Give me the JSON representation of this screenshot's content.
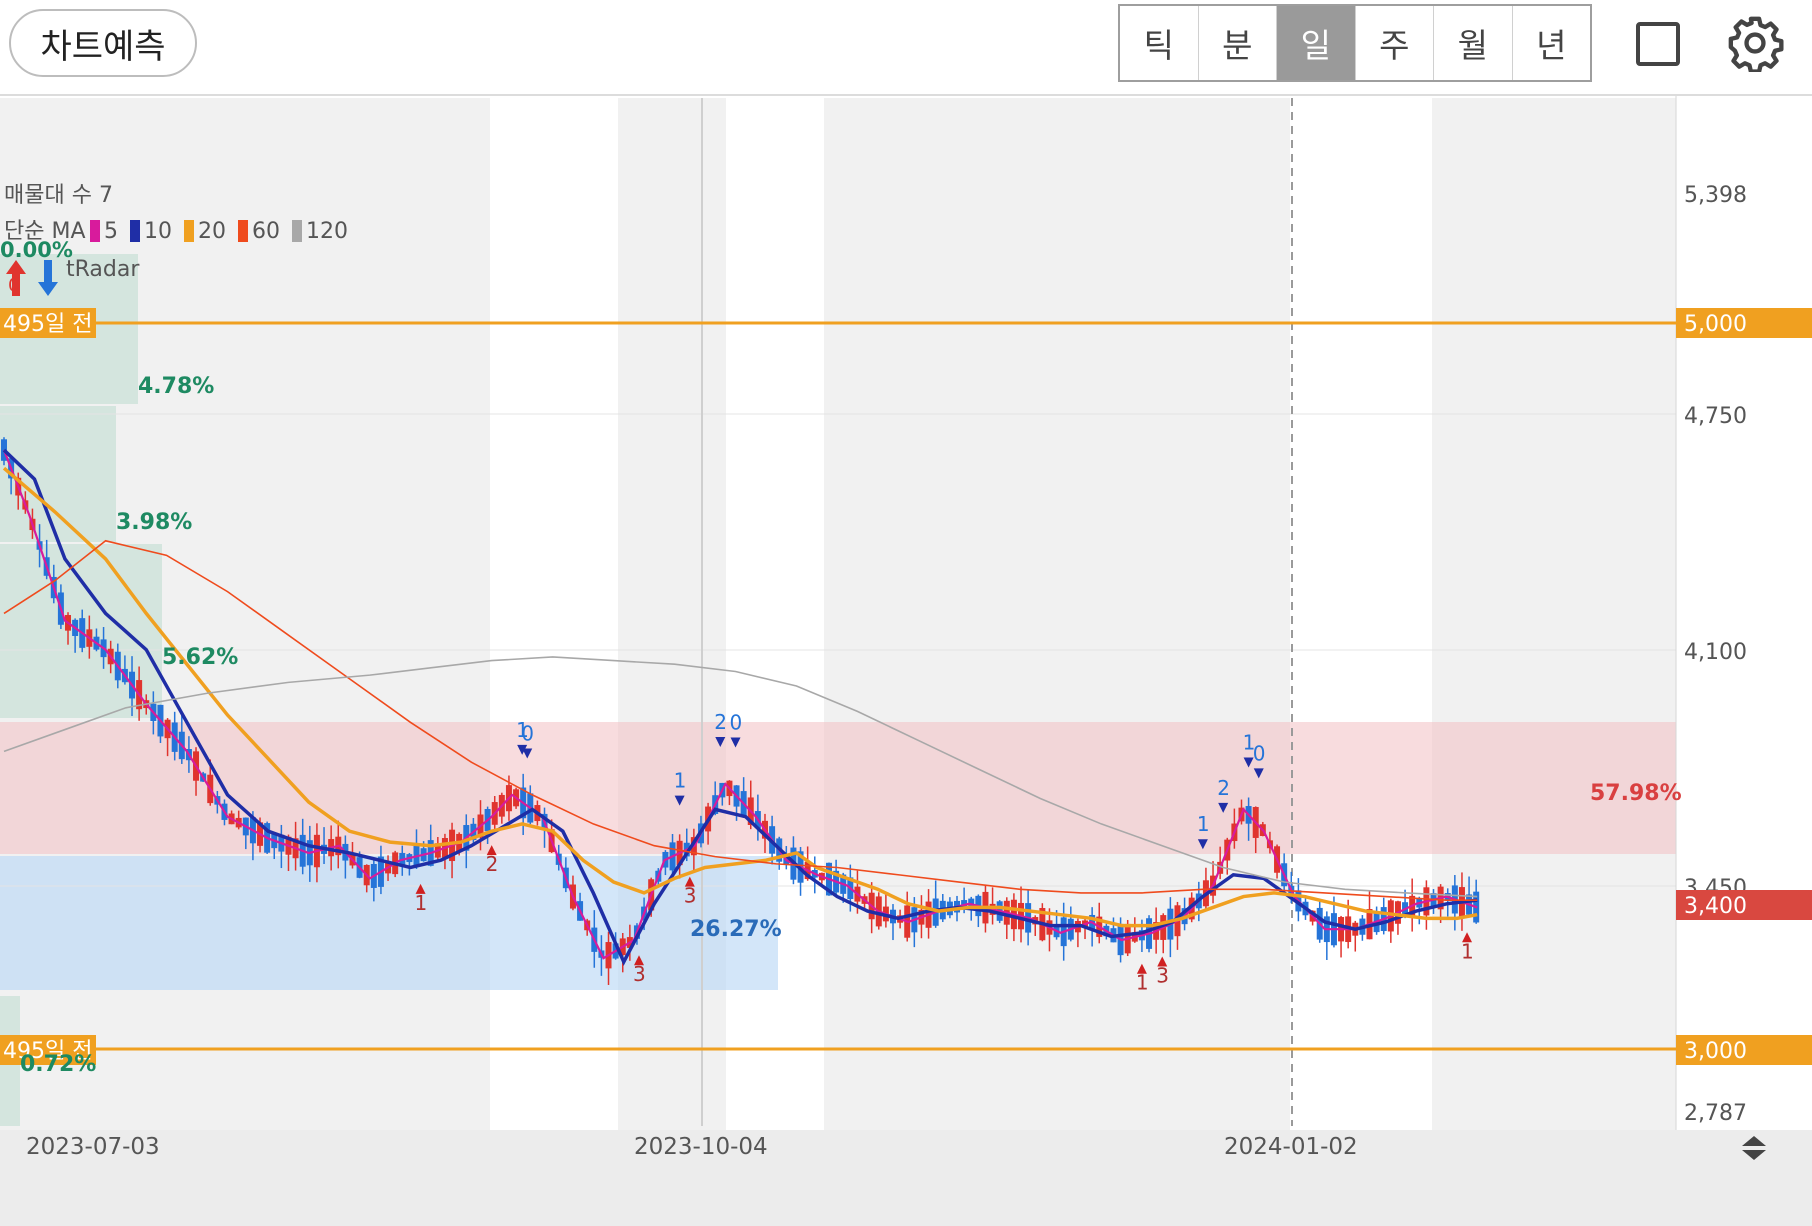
{
  "toolbar": {
    "predict_label": "차트예측",
    "periods": [
      "틱",
      "분",
      "일",
      "주",
      "월",
      "년"
    ],
    "active_period": "일",
    "fullscreen_icon": "square-icon",
    "settings_icon": "gear-icon"
  },
  "indicators": {
    "volume_profile": "매물대 수 7",
    "ma_prefix": "단순 MA",
    "ma_lines": [
      {
        "period": "5",
        "color": "#d81b9c"
      },
      {
        "period": "10",
        "color": "#1f2ea6"
      },
      {
        "period": "20",
        "color": "#f0a020"
      },
      {
        "period": "60",
        "color": "#ef4b1d"
      },
      {
        "period": "120",
        "color": "#a8a8a8"
      }
    ],
    "radar_label": "tRadar",
    "radar_pct": "0.00%",
    "radar_count": "0"
  },
  "colors": {
    "up": "#e0342e",
    "down": "#2574d8",
    "support_line": "#f0a020",
    "resistance_zone": "#f3c4c8",
    "support_zone": "#bcd9f6"
  },
  "chart_data": {
    "type": "candlestick",
    "y_axis": {
      "ticks": [
        "5,398",
        "5,000",
        "4,750",
        "4,100",
        "3,450",
        "2,787"
      ],
      "range": [
        2787,
        5398
      ],
      "current_price": "3,400",
      "line_levels": [
        {
          "label": "5,000",
          "value": 5000,
          "tag": "495일 전"
        },
        {
          "label": "3,000",
          "value": 3000,
          "tag": "495일 전"
        }
      ]
    },
    "x_axis": {
      "labels": [
        "2023-07-03",
        "2023-10-04",
        "2024-01-02"
      ]
    },
    "annotations": {
      "profile_pcts": [
        "4.78%",
        "3.98%",
        "5.62%",
        "26.27%",
        "0.72%"
      ],
      "zone_pct": "57.98%",
      "signals": [
        {
          "day": 102,
          "text": "1",
          "dir": "down"
        },
        {
          "day": 103,
          "text": "0",
          "dir": "down"
        },
        {
          "day": 96,
          "text": "2",
          "dir": "up"
        },
        {
          "day": 82,
          "text": "1",
          "dir": "up"
        },
        {
          "day": 125,
          "text": "3",
          "dir": "up"
        },
        {
          "day": 133,
          "text": "1",
          "dir": "down"
        },
        {
          "day": 141,
          "text": "2",
          "dir": "down"
        },
        {
          "day": 144,
          "text": "0",
          "dir": "down"
        },
        {
          "day": 135,
          "text": "3",
          "dir": "up"
        },
        {
          "day": 224,
          "text": "1",
          "dir": "up"
        },
        {
          "day": 228,
          "text": "3",
          "dir": "up"
        },
        {
          "day": 236,
          "text": "1",
          "dir": "down"
        },
        {
          "day": 240,
          "text": "2",
          "dir": "down"
        },
        {
          "day": 245,
          "text": "1",
          "dir": "down"
        },
        {
          "day": 247,
          "text": "0",
          "dir": "down"
        },
        {
          "day": 288,
          "text": "1",
          "dir": "up"
        }
      ]
    },
    "moving_averages": [
      {
        "name": "MA5",
        "color": "#d81b9c",
        "points": [
          [
            0,
            4650
          ],
          [
            5,
            4470
          ],
          [
            12,
            4180
          ],
          [
            20,
            4100
          ],
          [
            28,
            3950
          ],
          [
            36,
            3820
          ],
          [
            44,
            3640
          ],
          [
            52,
            3580
          ],
          [
            60,
            3540
          ],
          [
            66,
            3560
          ],
          [
            72,
            3470
          ],
          [
            78,
            3520
          ],
          [
            84,
            3540
          ],
          [
            90,
            3570
          ],
          [
            96,
            3640
          ],
          [
            100,
            3700
          ],
          [
            106,
            3640
          ],
          [
            112,
            3420
          ],
          [
            118,
            3250
          ],
          [
            124,
            3300
          ],
          [
            130,
            3520
          ],
          [
            136,
            3560
          ],
          [
            142,
            3730
          ],
          [
            148,
            3640
          ],
          [
            154,
            3520
          ],
          [
            160,
            3480
          ],
          [
            166,
            3450
          ],
          [
            172,
            3380
          ],
          [
            178,
            3350
          ],
          [
            184,
            3380
          ],
          [
            190,
            3400
          ],
          [
            196,
            3380
          ],
          [
            202,
            3360
          ],
          [
            208,
            3320
          ],
          [
            214,
            3350
          ],
          [
            220,
            3300
          ],
          [
            226,
            3320
          ],
          [
            232,
            3360
          ],
          [
            238,
            3450
          ],
          [
            244,
            3660
          ],
          [
            248,
            3600
          ],
          [
            254,
            3420
          ],
          [
            260,
            3330
          ],
          [
            266,
            3330
          ],
          [
            272,
            3360
          ],
          [
            278,
            3400
          ],
          [
            284,
            3420
          ],
          [
            290,
            3390
          ]
        ]
      },
      {
        "name": "MA10",
        "color": "#1f2ea6",
        "points": [
          [
            0,
            4650
          ],
          [
            6,
            4570
          ],
          [
            12,
            4350
          ],
          [
            20,
            4200
          ],
          [
            28,
            4100
          ],
          [
            36,
            3900
          ],
          [
            44,
            3700
          ],
          [
            52,
            3600
          ],
          [
            60,
            3560
          ],
          [
            68,
            3540
          ],
          [
            74,
            3520
          ],
          [
            80,
            3500
          ],
          [
            86,
            3520
          ],
          [
            92,
            3560
          ],
          [
            98,
            3610
          ],
          [
            104,
            3660
          ],
          [
            110,
            3600
          ],
          [
            116,
            3430
          ],
          [
            122,
            3240
          ],
          [
            128,
            3400
          ],
          [
            134,
            3530
          ],
          [
            140,
            3660
          ],
          [
            146,
            3640
          ],
          [
            152,
            3560
          ],
          [
            158,
            3480
          ],
          [
            164,
            3420
          ],
          [
            170,
            3380
          ],
          [
            176,
            3360
          ],
          [
            182,
            3380
          ],
          [
            188,
            3390
          ],
          [
            194,
            3380
          ],
          [
            200,
            3360
          ],
          [
            206,
            3340
          ],
          [
            212,
            3340
          ],
          [
            218,
            3310
          ],
          [
            224,
            3320
          ],
          [
            230,
            3350
          ],
          [
            236,
            3420
          ],
          [
            242,
            3480
          ],
          [
            248,
            3470
          ],
          [
            254,
            3410
          ],
          [
            260,
            3350
          ],
          [
            266,
            3330
          ],
          [
            272,
            3350
          ],
          [
            278,
            3380
          ],
          [
            284,
            3400
          ],
          [
            290,
            3410
          ]
        ]
      },
      {
        "name": "MA20",
        "color": "#f0a020",
        "points": [
          [
            0,
            4600
          ],
          [
            10,
            4480
          ],
          [
            20,
            4350
          ],
          [
            28,
            4200
          ],
          [
            36,
            4060
          ],
          [
            44,
            3920
          ],
          [
            52,
            3800
          ],
          [
            60,
            3680
          ],
          [
            68,
            3600
          ],
          [
            76,
            3570
          ],
          [
            84,
            3560
          ],
          [
            90,
            3570
          ],
          [
            96,
            3600
          ],
          [
            102,
            3620
          ],
          [
            108,
            3600
          ],
          [
            114,
            3520
          ],
          [
            120,
            3460
          ],
          [
            126,
            3430
          ],
          [
            132,
            3470
          ],
          [
            138,
            3500
          ],
          [
            144,
            3510
          ],
          [
            150,
            3520
          ],
          [
            156,
            3540
          ],
          [
            160,
            3500
          ],
          [
            166,
            3470
          ],
          [
            172,
            3440
          ],
          [
            178,
            3400
          ],
          [
            184,
            3380
          ],
          [
            190,
            3390
          ],
          [
            196,
            3390
          ],
          [
            202,
            3380
          ],
          [
            208,
            3370
          ],
          [
            214,
            3360
          ],
          [
            220,
            3340
          ],
          [
            226,
            3340
          ],
          [
            232,
            3360
          ],
          [
            238,
            3390
          ],
          [
            244,
            3420
          ],
          [
            250,
            3430
          ],
          [
            256,
            3420
          ],
          [
            262,
            3400
          ],
          [
            268,
            3380
          ],
          [
            274,
            3370
          ],
          [
            280,
            3360
          ],
          [
            286,
            3360
          ],
          [
            290,
            3370
          ]
        ]
      },
      {
        "name": "MA60",
        "color": "#ef4b1d",
        "points": [
          [
            0,
            4200
          ],
          [
            10,
            4290
          ],
          [
            20,
            4400
          ],
          [
            32,
            4360
          ],
          [
            44,
            4260
          ],
          [
            56,
            4140
          ],
          [
            68,
            4020
          ],
          [
            80,
            3900
          ],
          [
            92,
            3790
          ],
          [
            104,
            3700
          ],
          [
            116,
            3620
          ],
          [
            128,
            3560
          ],
          [
            140,
            3530
          ],
          [
            152,
            3510
          ],
          [
            164,
            3500
          ],
          [
            176,
            3480
          ],
          [
            188,
            3460
          ],
          [
            200,
            3440
          ],
          [
            212,
            3430
          ],
          [
            224,
            3430
          ],
          [
            236,
            3440
          ],
          [
            248,
            3440
          ],
          [
            260,
            3430
          ],
          [
            272,
            3420
          ],
          [
            284,
            3410
          ],
          [
            290,
            3410
          ]
        ]
      },
      {
        "name": "MA120",
        "color": "#a8a8a8",
        "points": [
          [
            0,
            3820
          ],
          [
            12,
            3880
          ],
          [
            24,
            3940
          ],
          [
            40,
            3980
          ],
          [
            56,
            4010
          ],
          [
            72,
            4030
          ],
          [
            84,
            4050
          ],
          [
            96,
            4070
          ],
          [
            108,
            4080
          ],
          [
            120,
            4070
          ],
          [
            132,
            4060
          ],
          [
            144,
            4040
          ],
          [
            156,
            4000
          ],
          [
            168,
            3930
          ],
          [
            180,
            3850
          ],
          [
            192,
            3770
          ],
          [
            204,
            3690
          ],
          [
            216,
            3620
          ],
          [
            228,
            3560
          ],
          [
            240,
            3500
          ],
          [
            252,
            3460
          ],
          [
            264,
            3440
          ],
          [
            276,
            3430
          ],
          [
            290,
            3420
          ]
        ]
      }
    ]
  }
}
